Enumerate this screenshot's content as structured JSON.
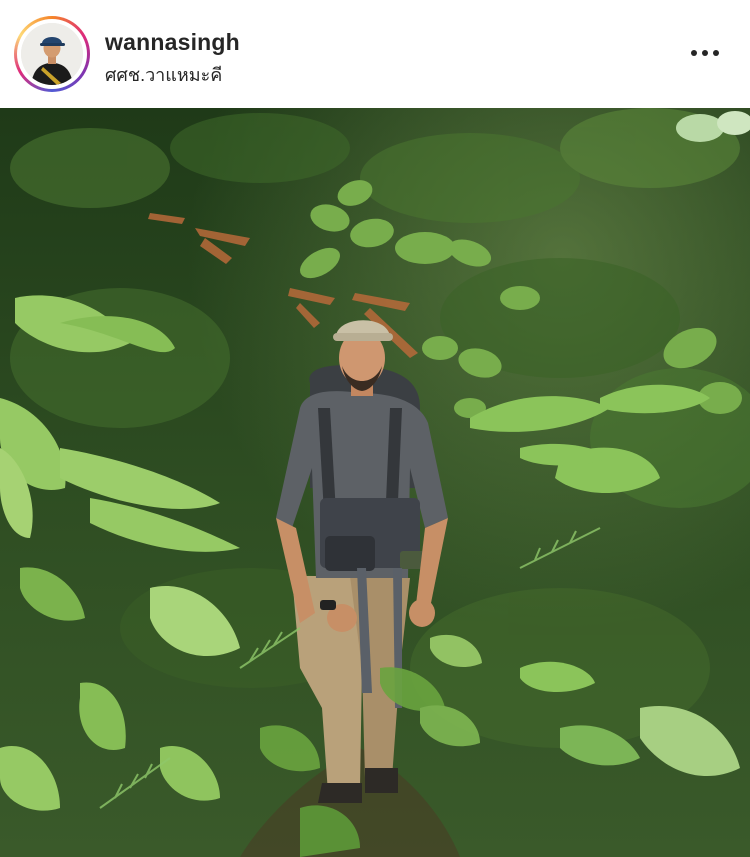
{
  "post": {
    "username": "wannasingh",
    "location": "ศศช.วาแหมะคี",
    "avatar_icon": "profile-avatar",
    "more_icon": "more-options-icon",
    "photo_description_icon": "jungle-hiker-photo"
  },
  "colors": {
    "text": "#262626",
    "background": "#ffffff",
    "story_ring_start": "#f58529",
    "story_ring_end": "#dd2a7b"
  }
}
